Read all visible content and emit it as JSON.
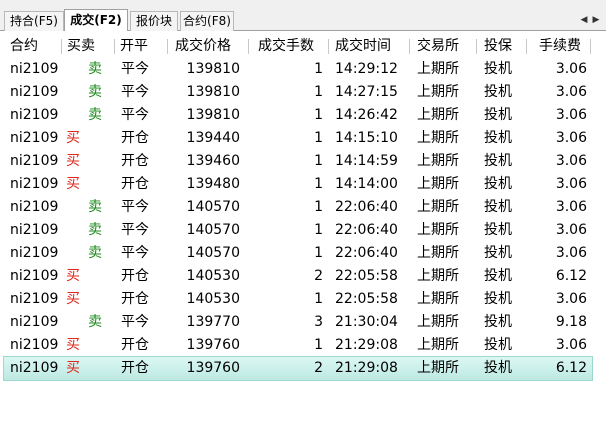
{
  "tabs": [
    {
      "label": "持合(F5)",
      "active": false
    },
    {
      "label": "成交(F2)",
      "active": true
    },
    {
      "label": "报价块",
      "active": false
    },
    {
      "label": "合约(F8)",
      "active": false
    }
  ],
  "nav": {
    "prev": "◀",
    "next": "▶"
  },
  "columns": [
    "合约",
    "买卖",
    "开平",
    "成交价格",
    "成交手数",
    "成交时间",
    "交易所",
    "投保",
    "手续费"
  ],
  "colors": {
    "buy": "#e0281e",
    "sell": "#1a8a1a",
    "selected_row": "#c9efe9"
  },
  "rows": [
    {
      "contract": "ni2109",
      "side": "卖",
      "side_type": "sell",
      "offset": "平今",
      "price": "139810",
      "qty": "1",
      "time": "14:29:12",
      "exchange": "上期所",
      "hedge": "投机",
      "fee": "3.06",
      "selected": false
    },
    {
      "contract": "ni2109",
      "side": "卖",
      "side_type": "sell",
      "offset": "平今",
      "price": "139810",
      "qty": "1",
      "time": "14:27:15",
      "exchange": "上期所",
      "hedge": "投机",
      "fee": "3.06",
      "selected": false
    },
    {
      "contract": "ni2109",
      "side": "卖",
      "side_type": "sell",
      "offset": "平今",
      "price": "139810",
      "qty": "1",
      "time": "14:26:42",
      "exchange": "上期所",
      "hedge": "投机",
      "fee": "3.06",
      "selected": false
    },
    {
      "contract": "ni2109",
      "side": "买",
      "side_type": "buy",
      "offset": "开仓",
      "price": "139440",
      "qty": "1",
      "time": "14:15:10",
      "exchange": "上期所",
      "hedge": "投机",
      "fee": "3.06",
      "selected": false
    },
    {
      "contract": "ni2109",
      "side": "买",
      "side_type": "buy",
      "offset": "开仓",
      "price": "139460",
      "qty": "1",
      "time": "14:14:59",
      "exchange": "上期所",
      "hedge": "投机",
      "fee": "3.06",
      "selected": false
    },
    {
      "contract": "ni2109",
      "side": "买",
      "side_type": "buy",
      "offset": "开仓",
      "price": "139480",
      "qty": "1",
      "time": "14:14:00",
      "exchange": "上期所",
      "hedge": "投机",
      "fee": "3.06",
      "selected": false
    },
    {
      "contract": "ni2109",
      "side": "卖",
      "side_type": "sell",
      "offset": "平今",
      "price": "140570",
      "qty": "1",
      "time": "22:06:40",
      "exchange": "上期所",
      "hedge": "投机",
      "fee": "3.06",
      "selected": false
    },
    {
      "contract": "ni2109",
      "side": "卖",
      "side_type": "sell",
      "offset": "平今",
      "price": "140570",
      "qty": "1",
      "time": "22:06:40",
      "exchange": "上期所",
      "hedge": "投机",
      "fee": "3.06",
      "selected": false
    },
    {
      "contract": "ni2109",
      "side": "卖",
      "side_type": "sell",
      "offset": "平今",
      "price": "140570",
      "qty": "1",
      "time": "22:06:40",
      "exchange": "上期所",
      "hedge": "投机",
      "fee": "3.06",
      "selected": false
    },
    {
      "contract": "ni2109",
      "side": "买",
      "side_type": "buy",
      "offset": "开仓",
      "price": "140530",
      "qty": "2",
      "time": "22:05:58",
      "exchange": "上期所",
      "hedge": "投机",
      "fee": "6.12",
      "selected": false
    },
    {
      "contract": "ni2109",
      "side": "买",
      "side_type": "buy",
      "offset": "开仓",
      "price": "140530",
      "qty": "1",
      "time": "22:05:58",
      "exchange": "上期所",
      "hedge": "投机",
      "fee": "3.06",
      "selected": false
    },
    {
      "contract": "ni2109",
      "side": "卖",
      "side_type": "sell",
      "offset": "平今",
      "price": "139770",
      "qty": "3",
      "time": "21:30:04",
      "exchange": "上期所",
      "hedge": "投机",
      "fee": "9.18",
      "selected": false
    },
    {
      "contract": "ni2109",
      "side": "买",
      "side_type": "buy",
      "offset": "开仓",
      "price": "139760",
      "qty": "1",
      "time": "21:29:08",
      "exchange": "上期所",
      "hedge": "投机",
      "fee": "3.06",
      "selected": false
    },
    {
      "contract": "ni2109",
      "side": "买",
      "side_type": "buy",
      "offset": "开仓",
      "price": "139760",
      "qty": "2",
      "time": "21:29:08",
      "exchange": "上期所",
      "hedge": "投机",
      "fee": "6.12",
      "selected": true
    }
  ]
}
